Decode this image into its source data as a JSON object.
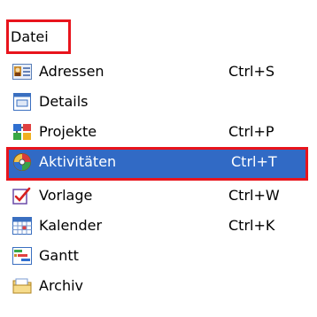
{
  "menu": {
    "title": "Datei",
    "items": [
      {
        "label": "Adressen",
        "shortcut": "Ctrl+S",
        "icon": "address-card-icon"
      },
      {
        "label": "Details",
        "shortcut": "",
        "icon": "details-window-icon"
      },
      {
        "label": "Projekte",
        "shortcut": "Ctrl+P",
        "icon": "projects-icon"
      },
      {
        "label": "Aktivitäten",
        "shortcut": "Ctrl+T",
        "icon": "activities-icon",
        "selected": true
      },
      {
        "label": "Vorlage",
        "shortcut": "Ctrl+W",
        "icon": "template-checkbox-icon"
      },
      {
        "label": "Kalender",
        "shortcut": "Ctrl+K",
        "icon": "calendar-icon"
      },
      {
        "label": "Gantt",
        "shortcut": "",
        "icon": "gantt-icon"
      },
      {
        "label": "Archiv",
        "shortcut": "",
        "icon": "archive-folder-icon"
      }
    ]
  },
  "colors": {
    "highlight_border": "#e8141c",
    "selection_background": "#316ac5"
  }
}
